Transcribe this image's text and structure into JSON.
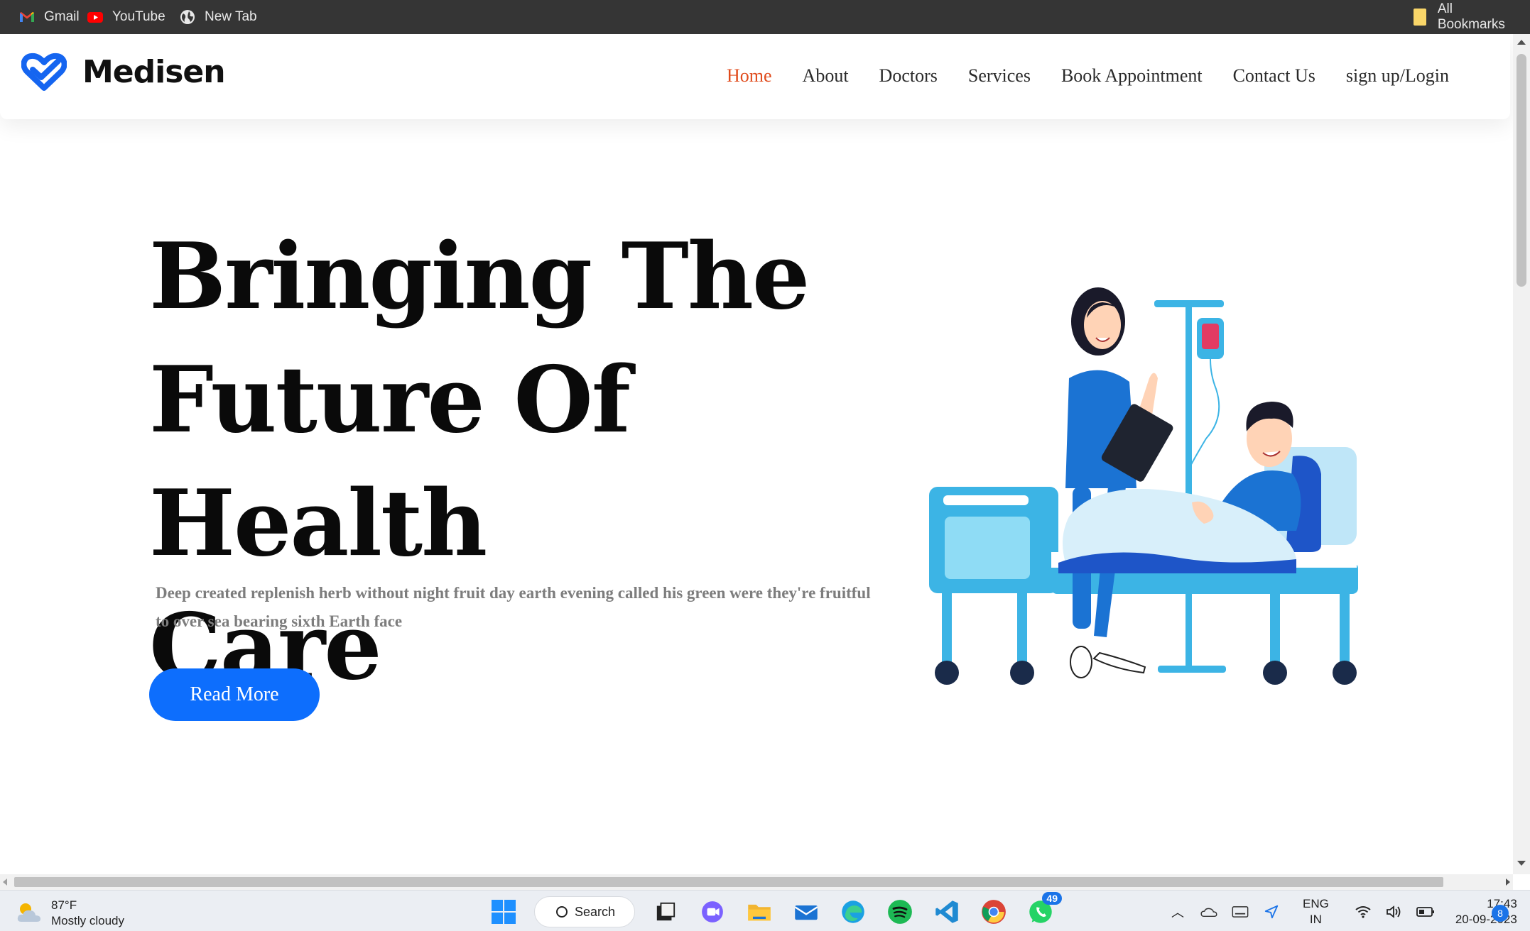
{
  "bookmarks": {
    "items": [
      {
        "label": "Gmail",
        "icon": "gmail-icon"
      },
      {
        "label": "YouTube",
        "icon": "youtube-icon"
      },
      {
        "label": "New Tab",
        "icon": "globe-icon"
      }
    ],
    "all_bookmarks": "All Bookmarks"
  },
  "site": {
    "brand": "Medisen",
    "nav": [
      {
        "label": "Home",
        "active": true
      },
      {
        "label": "About"
      },
      {
        "label": "Doctors"
      },
      {
        "label": "Services"
      },
      {
        "label": "Book Appointment"
      },
      {
        "label": "Contact Us"
      },
      {
        "label": "sign up/Login"
      }
    ],
    "accent_color": "#e04b1c",
    "button_color": "#0d6efd"
  },
  "hero": {
    "title_line1": "Bringing The",
    "title_line2": "Future Of Health",
    "title_line3": "Care",
    "description_line1": "Deep created replenish herb without night fruit day earth evening called his green were they're fruitful",
    "description_line2": "to over sea bearing sixth Earth face",
    "cta": "Read More",
    "illustration": "nurse-and-patient-hospital-bed-illustration"
  },
  "taskbar": {
    "weather_temp": "87°F",
    "weather_desc": "Mostly cloudy",
    "search_label": "Search",
    "whatsapp_badge": "49",
    "lang_line1": "ENG",
    "lang_line2": "IN",
    "time": "17:43",
    "date": "20-09-2023",
    "notification_count": "8"
  }
}
